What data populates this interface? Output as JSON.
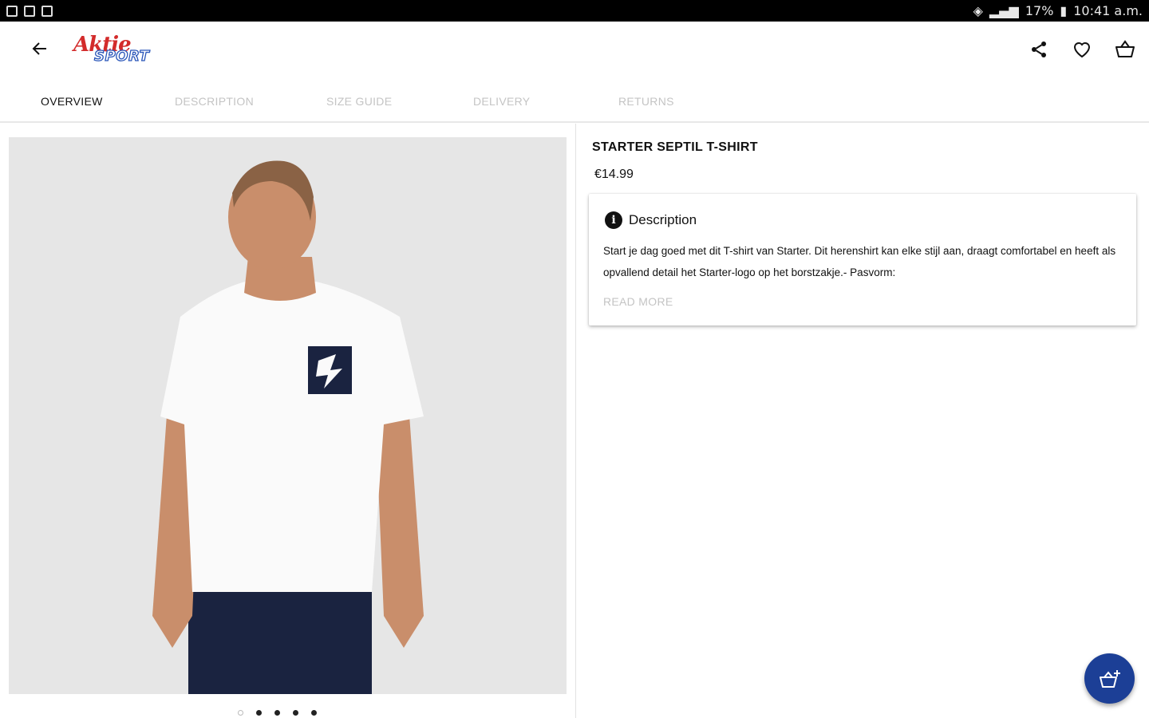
{
  "status_bar": {
    "battery": "17%",
    "time": "10:41 a.m."
  },
  "appbar": {
    "logo_top": "Aktie",
    "logo_bottom": "SPORT",
    "icons": [
      "back-arrow-icon",
      "share-icon",
      "heart-icon",
      "basket-icon"
    ]
  },
  "tabs": [
    {
      "label": "OVERVIEW",
      "active": true
    },
    {
      "label": "DESCRIPTION",
      "active": false
    },
    {
      "label": "SIZE GUIDE",
      "active": false
    },
    {
      "label": "DELIVERY",
      "active": false
    },
    {
      "label": "RETURNS",
      "active": false
    }
  ],
  "gallery": {
    "total_images": 5,
    "current_index": 0
  },
  "product": {
    "title": "STARTER SEPTIL T-SHIRT",
    "price": "€14.99",
    "description_heading": "Description",
    "description_text": "Start je dag goed met dit T-shirt van Starter. Dit herenshirt kan elke stijl aan, draagt comfortabel en heeft als opvallend detail het Starter-logo op het borstzakje.- Pasvorm:",
    "read_more_label": "READ MORE"
  },
  "colors": {
    "brand_red": "#d32b2b",
    "brand_blue": "#2a56b9",
    "fab_blue": "#1c3f96"
  }
}
